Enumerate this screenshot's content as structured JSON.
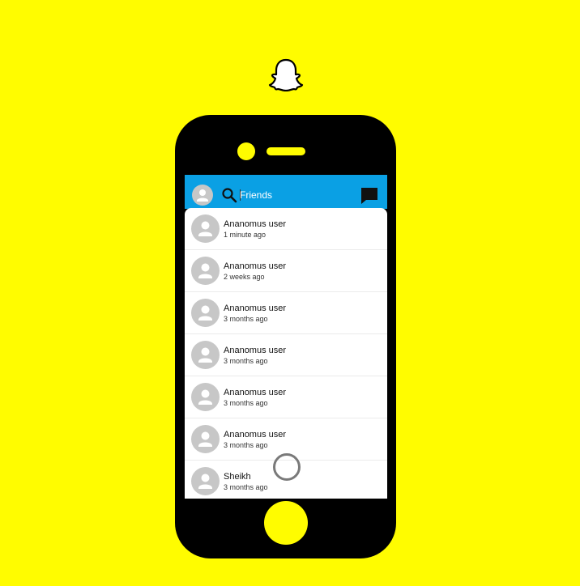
{
  "colors": {
    "background": "#FFFC00",
    "header": "#0AA0E4",
    "phone": "#000000",
    "avatar": "#C7C7C7"
  },
  "header": {
    "search_placeholder": "Friends",
    "icons": [
      "avatar-icon",
      "search-icon",
      "chat-icon"
    ]
  },
  "conversations": [
    {
      "name": "Ananomus user",
      "time": "1 minute ago"
    },
    {
      "name": "Ananomus user",
      "time": "2 weeks ago"
    },
    {
      "name": "Ananomus user",
      "time": "3 months ago"
    },
    {
      "name": "Ananomus user",
      "time": "3 months ago"
    },
    {
      "name": "Ananomus user",
      "time": "3 months ago"
    },
    {
      "name": "Ananomus user",
      "time": "3 months ago"
    },
    {
      "name": "Sheikh",
      "time": "3 months ago"
    }
  ]
}
